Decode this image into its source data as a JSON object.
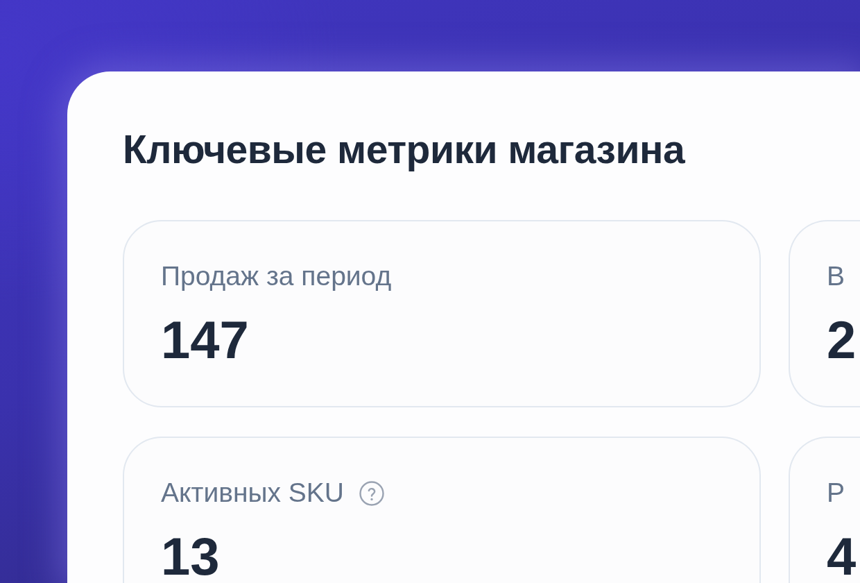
{
  "panel": {
    "title": "Ключевые метрики магазина"
  },
  "metrics": [
    {
      "label": "Продаж за период",
      "value": "147",
      "help": false
    },
    {
      "label": "В",
      "value": "2"
    },
    {
      "label": "Активных SKU",
      "value": "13",
      "help": true
    },
    {
      "label": "Р",
      "value": "4"
    }
  ]
}
